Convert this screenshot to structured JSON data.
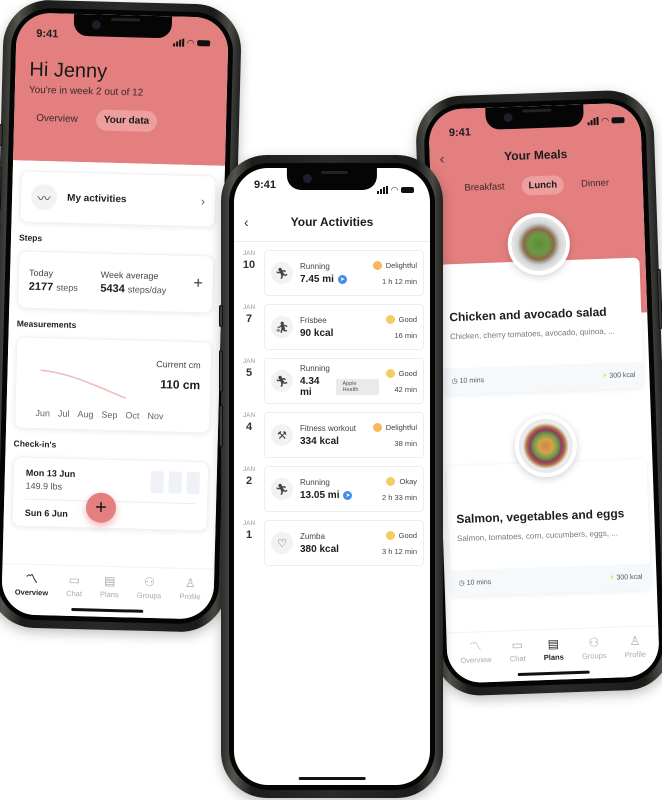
{
  "status_time": "9:41",
  "phone_overview": {
    "greeting": "Hi Jenny",
    "subtitle": "You're in week 2 out of 12",
    "tabs": [
      {
        "label": "Overview",
        "active": false
      },
      {
        "label": "Your data",
        "active": true
      }
    ],
    "activities_link": {
      "icon": "activity-wave-icon",
      "label": "My activities"
    },
    "steps": {
      "section_title": "Steps",
      "today_label": "Today",
      "today_value": "2177",
      "today_unit": "steps",
      "week_label": "Week average",
      "week_value": "5434",
      "week_unit": "steps/day"
    },
    "measurements": {
      "section_title": "Measurements",
      "current_label": "Current cm",
      "current_value": "110 cm",
      "months": [
        "Jun",
        "Jul",
        "Aug",
        "Sep",
        "Oct",
        "Nov"
      ]
    },
    "checkins": {
      "section_title": "Check-in's",
      "entries": [
        {
          "date": "Mon 13 Jun",
          "weight": "149.9 lbs"
        },
        {
          "date": "Sun 6 Jun",
          "weight": ""
        }
      ]
    },
    "fab_label": "+",
    "tabbar": [
      {
        "label": "Overview",
        "icon": "overview-icon",
        "active": true
      },
      {
        "label": "Chat",
        "icon": "chat-icon",
        "active": false
      },
      {
        "label": "Plans",
        "icon": "plans-icon",
        "active": false
      },
      {
        "label": "Groups",
        "icon": "groups-icon",
        "active": false
      },
      {
        "label": "Profile",
        "icon": "profile-icon",
        "active": false
      }
    ]
  },
  "phone_activities": {
    "title": "Your Activities",
    "items": [
      {
        "month": "JAN",
        "day": "10",
        "name": "Running",
        "value": "7.45 mi",
        "source": "strava",
        "mood": "Delightful",
        "duration": "1 h 12 min",
        "icon": "running-icon"
      },
      {
        "month": "JAN",
        "day": "7",
        "name": "Frisbee",
        "value": "90 kcal",
        "source": "",
        "mood": "Good",
        "duration": "16 min",
        "icon": "frisbee-icon"
      },
      {
        "month": "JAN",
        "day": "5",
        "name": "Running",
        "value": "4.34 mi",
        "source": "Apple Health",
        "mood": "Good",
        "duration": "42 min",
        "icon": "running-icon"
      },
      {
        "month": "JAN",
        "day": "4",
        "name": "Fitness workout",
        "value": "334 kcal",
        "source": "",
        "mood": "Delightful",
        "duration": "38 min",
        "icon": "dumbbell-icon"
      },
      {
        "month": "JAN",
        "day": "2",
        "name": "Running",
        "value": "13.05 mi",
        "source": "strava",
        "mood": "Okay",
        "duration": "2 h 33 min",
        "icon": "running-icon"
      },
      {
        "month": "JAN",
        "day": "1",
        "name": "Zumba",
        "value": "380 kcal",
        "source": "",
        "mood": "Good",
        "duration": "3 h 12 min",
        "icon": "heart-rate-icon"
      }
    ]
  },
  "phone_meals": {
    "title": "Your Meals",
    "tabs": [
      {
        "label": "Breakfast",
        "active": false
      },
      {
        "label": "Lunch",
        "active": true
      },
      {
        "label": "Dinner",
        "active": false
      }
    ],
    "meals": [
      {
        "name": "Chicken and avocado salad",
        "description": "Chicken, cherry tomatoes, avocado, quinoa, ...",
        "time": "10 mins",
        "calories": "300 kcal"
      },
      {
        "name": "Salmon, vegetables and eggs",
        "description": "Salmon, tomatoes, corn, cucumbers, eggs, ...",
        "time": "10 mins",
        "calories": "300 kcal"
      }
    ],
    "tabbar": [
      {
        "label": "Overview",
        "icon": "overview-icon",
        "active": false
      },
      {
        "label": "Chat",
        "icon": "chat-icon",
        "active": false
      },
      {
        "label": "Plans",
        "icon": "plans-icon",
        "active": true
      },
      {
        "label": "Groups",
        "icon": "groups-icon",
        "active": false
      },
      {
        "label": "Profile",
        "icon": "profile-icon",
        "active": false
      }
    ]
  },
  "colors": {
    "brand_pink": "#e47f7f",
    "tab_pill": "#ee9e9e",
    "chart_line": "#f0b8b8",
    "strava_blue": "#3f8ee8",
    "mood_yellow": "#f3cc62",
    "bolt_yellow": "#f1b829"
  }
}
